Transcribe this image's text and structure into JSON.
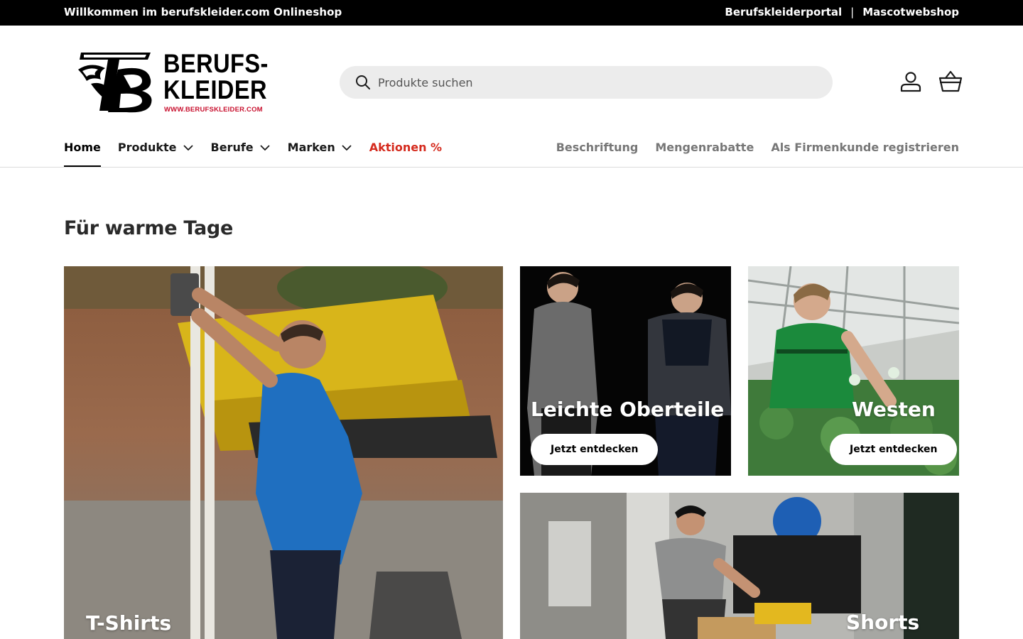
{
  "announcement": {
    "welcome": "Willkommen im berufskleider.com Onlineshop",
    "links": [
      "Berufskleiderportal",
      "Mascotwebshop"
    ],
    "separator": "|"
  },
  "logo": {
    "line1": "BERUFS-",
    "line2": "KLEIDER",
    "url": "WWW.BERUFSKLEIDER.COM"
  },
  "search": {
    "placeholder": "Produkte suchen"
  },
  "header_icons": [
    "account-icon",
    "cart-icon"
  ],
  "nav": {
    "items": [
      {
        "label": "Home",
        "active": true,
        "dropdown": false
      },
      {
        "label": "Produkte",
        "dropdown": true
      },
      {
        "label": "Berufe",
        "dropdown": true
      },
      {
        "label": "Marken",
        "dropdown": true
      },
      {
        "label": "Aktionen %",
        "dropdown": false,
        "highlight": true
      }
    ],
    "secondary": [
      "Beschriftung",
      "Mengenrabatte",
      "Als Firmenkunde registrieren"
    ]
  },
  "section": {
    "title": "Für warme Tage",
    "tiles": [
      {
        "label": "T-Shirts"
      },
      {
        "label": "Leichte Oberteile",
        "cta": "Jetzt entdecken"
      },
      {
        "label": "Westen",
        "cta": "Jetzt entdecken"
      },
      {
        "label": "Shorts"
      }
    ]
  },
  "colors": {
    "topbar": "#000000",
    "sale": "#d52b1e",
    "logo_url": "#c8102e",
    "search_bg": "#ececec",
    "secondary_nav": "#777777"
  }
}
